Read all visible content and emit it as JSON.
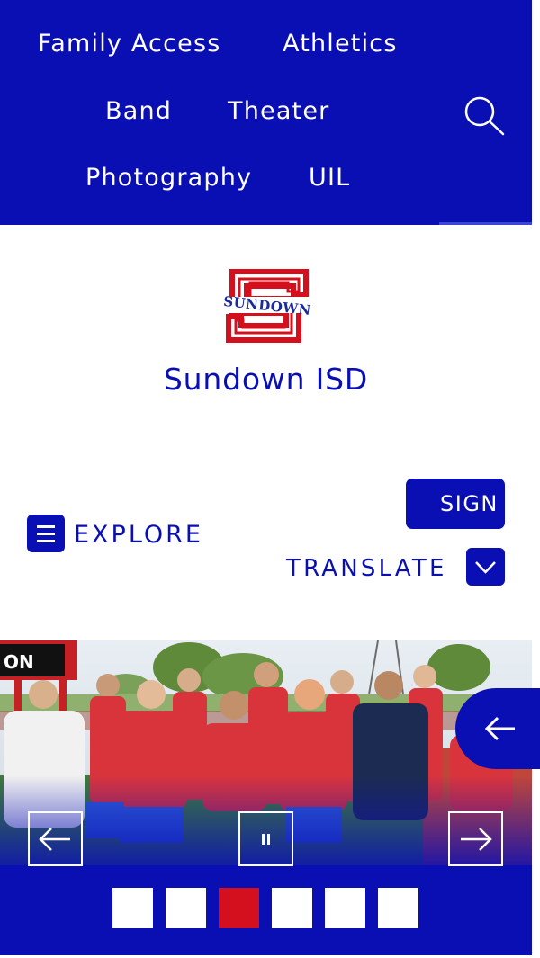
{
  "nav": {
    "items": [
      "Family Access",
      "Athletics",
      "Band",
      "Theater",
      "Photography",
      "UIL"
    ],
    "search_icon": "search-icon"
  },
  "header": {
    "logo_text": "SUNDOWN",
    "site_title": "Sundown ISD"
  },
  "actions": {
    "sign_label": "SIGN",
    "explore_label": "EXPLORE",
    "translate_label": "TRANSLATE"
  },
  "slideshow": {
    "slide_count": 6,
    "active_slide": 3,
    "scoreboard_text": "ON",
    "prev_icon": "arrow-left-icon",
    "pause_icon": "pause-icon",
    "next_icon": "arrow-right-icon"
  },
  "colors": {
    "brand_blue": "#0a0fb4",
    "accent_red": "#d4101e",
    "white": "#ffffff"
  }
}
